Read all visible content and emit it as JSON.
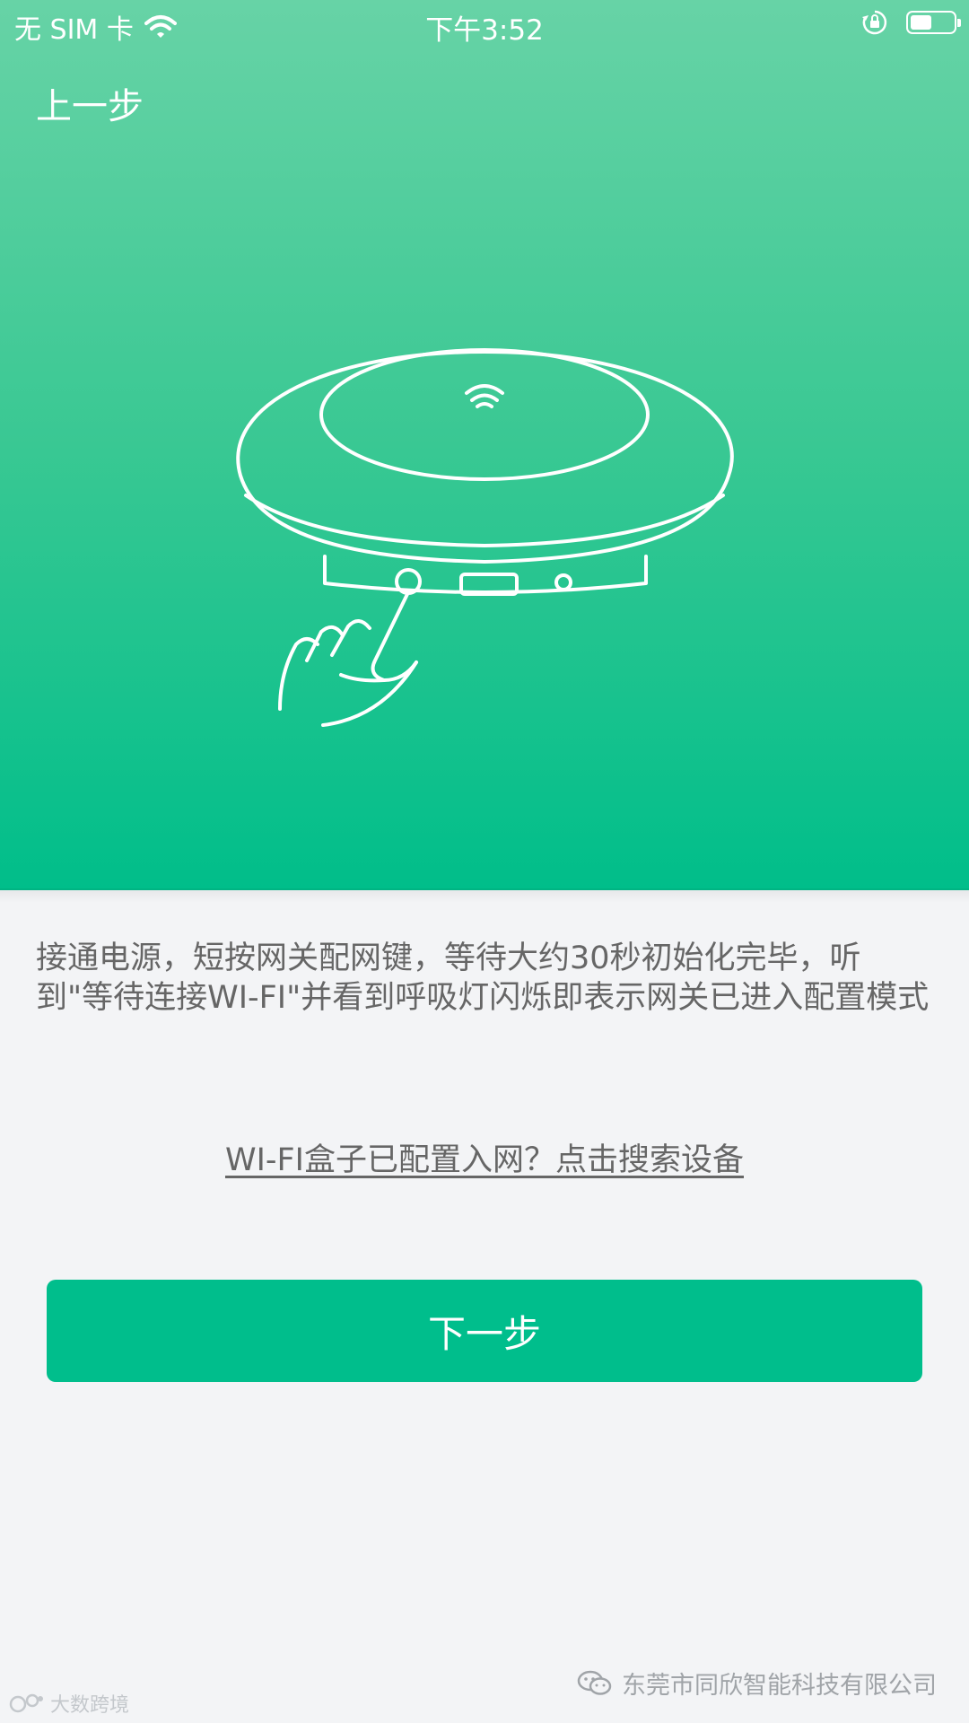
{
  "status_bar": {
    "carrier": "无 SIM 卡",
    "time": "下午3:52",
    "battery_level": 0.5
  },
  "nav": {
    "back_label": "上一步"
  },
  "instructions": {
    "text": "接通电源，短按网关配网键，等待大约30秒初始化完毕，听到\"等待连接WI-FI\"并看到呼吸灯闪烁即表示网关已进入配置模式"
  },
  "search_link": {
    "label": "WI-FI盒子已配置入网？点击搜索设备"
  },
  "next_button": {
    "label": "下一步"
  },
  "footer": {
    "company": "东莞市同欣智能科技有限公司",
    "corner_logo": "大数跨境"
  },
  "colors": {
    "hero_top": "#67d3a6",
    "hero_bottom": "#00be8a",
    "button": "#00be8c",
    "background": "#f3f4f6",
    "text_gray": "#666666"
  },
  "icons": [
    "wifi-icon",
    "rotation-lock-icon",
    "battery-icon",
    "gateway-device-illustration",
    "hand-pointer-icon",
    "wechat-icon"
  ]
}
